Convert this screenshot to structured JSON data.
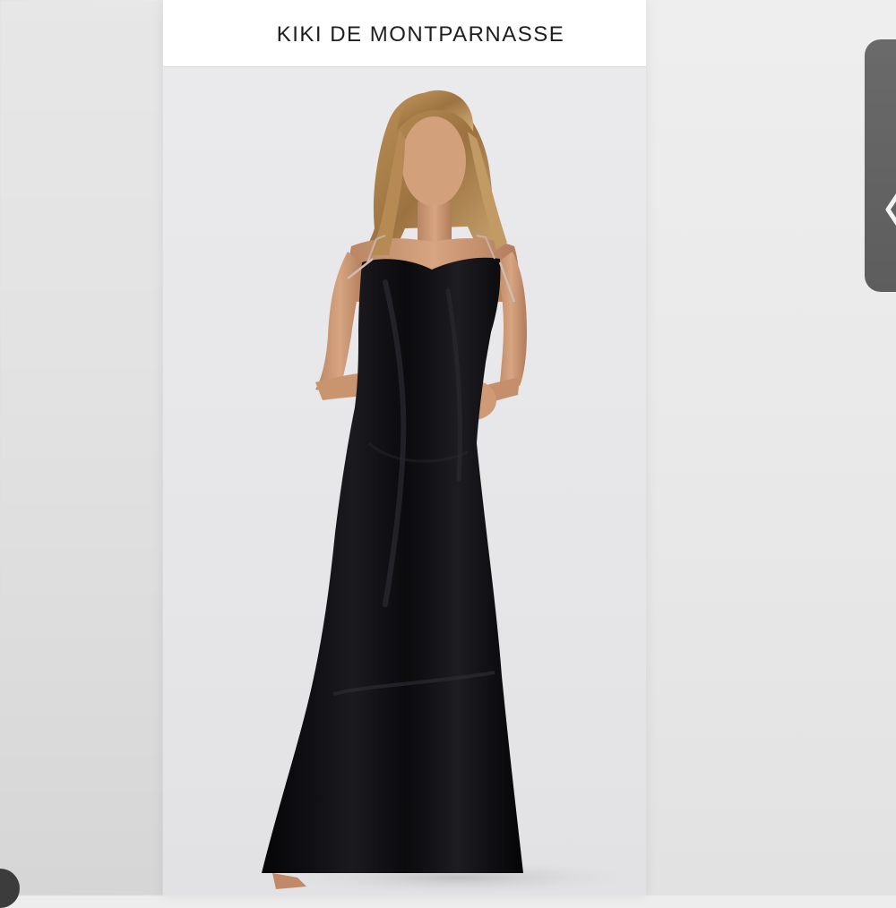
{
  "header": {
    "brand_name": "KIKI DE MONTPARNASSE"
  },
  "product_image": {
    "icon": "model-in-black-satin-slip-dress-image"
  },
  "side_panel": {
    "icon": "chevron-left-icon"
  },
  "colors": {
    "dress": "#0d0d10",
    "header_bg": "#ffffff",
    "photo_bg": "#e8e8ea",
    "side_panel": "#626262"
  }
}
